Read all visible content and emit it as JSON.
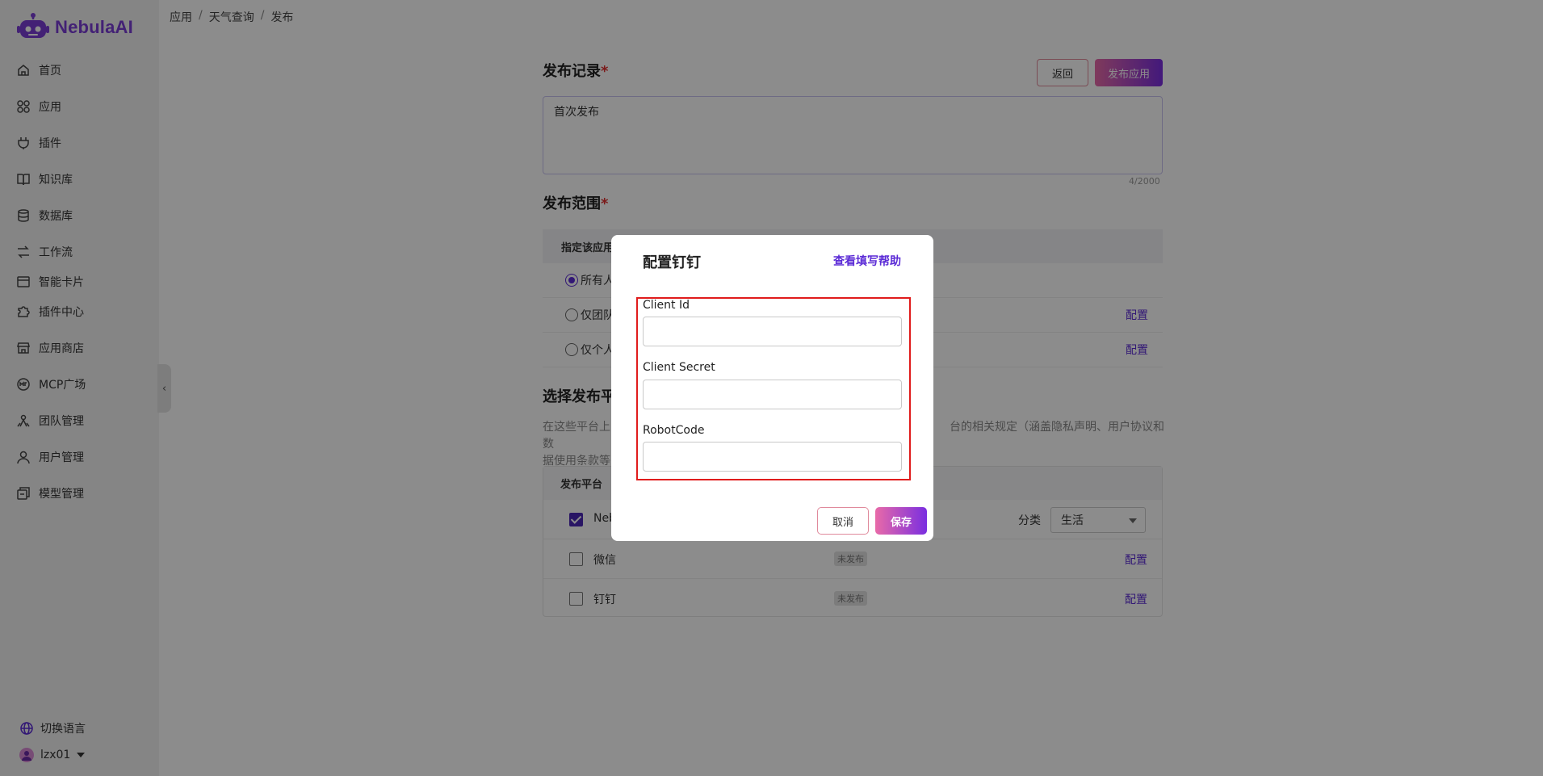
{
  "brand": {
    "name": "NebulaAI",
    "accent": "#7a3cd6"
  },
  "sidebar": {
    "items": [
      {
        "label": "首页",
        "icon": "home-icon"
      },
      {
        "label": "应用",
        "icon": "apps-icon"
      },
      {
        "label": "插件",
        "icon": "plug-icon"
      },
      {
        "label": "知识库",
        "icon": "book-icon"
      },
      {
        "label": "数据库",
        "icon": "database-icon"
      },
      {
        "label": "工作流",
        "icon": "workflow-icon"
      },
      {
        "label": "智能卡片",
        "icon": "card-icon"
      },
      {
        "label": "插件中心",
        "icon": "puzzle-icon"
      },
      {
        "label": "应用商店",
        "icon": "store-icon"
      },
      {
        "label": "MCP广场",
        "icon": "mcp-icon"
      },
      {
        "label": "团队管理",
        "icon": "team-icon"
      },
      {
        "label": "用户管理",
        "icon": "user-icon"
      },
      {
        "label": "模型管理",
        "icon": "model-icon"
      }
    ],
    "language": "切换语言",
    "username": "lzx01"
  },
  "breadcrumb": {
    "items": [
      "应用",
      "天气查询",
      "发布"
    ],
    "sep": "/"
  },
  "publish": {
    "record_title": "发布记录",
    "required_mark": "*",
    "back_label": "返回",
    "publish_label": "发布应用",
    "record_value": "首次发布",
    "counter": "4/2000"
  },
  "scope": {
    "title": "发布范围",
    "header": "指定该应用",
    "rows": [
      {
        "label": "所有人",
        "selected": true,
        "config": ""
      },
      {
        "label": "仅团队",
        "selected": false,
        "config": "配置"
      },
      {
        "label": "仅个人",
        "selected": false,
        "config": "配置"
      }
    ]
  },
  "platform": {
    "title": "选择发布平",
    "desc_left": "在这些平台上",
    "desc_right": "台的相关规定（涵盖隐私声明、用户协议和数",
    "desc_line2": "据使用条款等",
    "header": "发布平台",
    "category_label": "分类",
    "category_value": "生活",
    "rows": [
      {
        "name": "Neb",
        "checked": true,
        "status": "",
        "config": ""
      },
      {
        "name": "微信",
        "checked": false,
        "status": "未发布",
        "config": "配置"
      },
      {
        "name": "钉钉",
        "checked": false,
        "status": "未发布",
        "config": "配置"
      }
    ]
  },
  "modal": {
    "title": "配置钉钉",
    "help_link": "查看填写帮助",
    "fields": [
      {
        "label": "Client Id",
        "value": ""
      },
      {
        "label": "Client Secret",
        "value": ""
      },
      {
        "label": "RobotCode",
        "value": ""
      }
    ],
    "cancel_label": "取消",
    "save_label": "保存"
  }
}
